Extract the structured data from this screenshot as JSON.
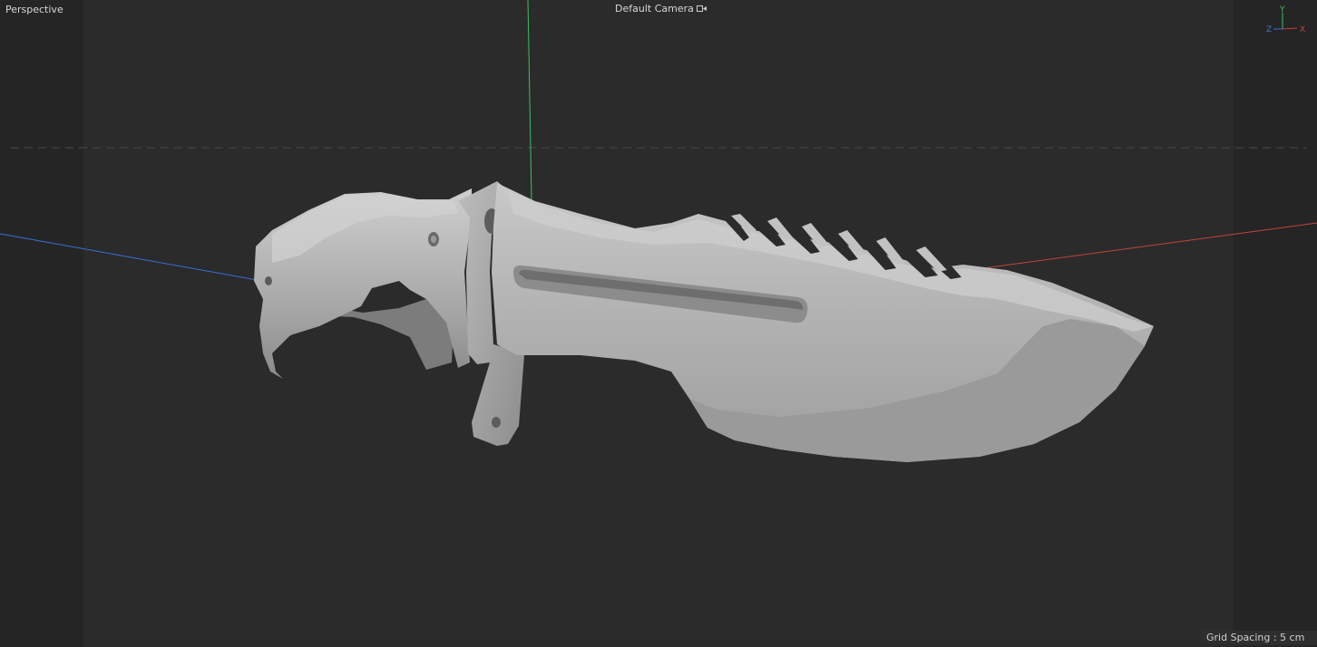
{
  "viewport": {
    "view_name": "Perspective",
    "camera_name": "Default Camera",
    "grid_spacing": "Grid Spacing : 5 cm"
  },
  "axis_gizmo": {
    "y_label": "Y",
    "z_label": "Z",
    "x_label": "X"
  },
  "icons": {
    "camera": "camera-icon",
    "axis": "axis-gizmo-icon"
  },
  "colors": {
    "x_axis": "#c0453f",
    "y_axis": "#3fbf62",
    "z_axis": "#3a6fd8",
    "background": "#2b2b2b",
    "model": "#b4b4b4"
  }
}
